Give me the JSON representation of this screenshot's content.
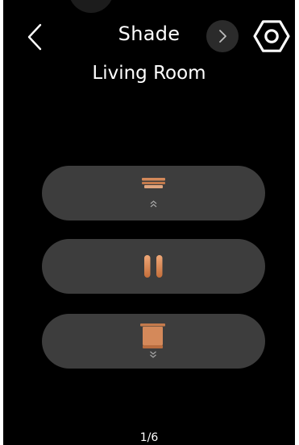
{
  "header": {
    "title": "Shade",
    "back_icon": "chevron-left-icon",
    "next_icon": "chevron-right-icon",
    "settings_icon": "hexagon-gear-icon"
  },
  "room": {
    "name": "Living Room"
  },
  "controls": [
    {
      "action": "open",
      "icon": "shade-open-icon"
    },
    {
      "action": "stop",
      "icon": "pause-icon"
    },
    {
      "action": "close",
      "icon": "shade-close-icon"
    }
  ],
  "pagination": {
    "text": "1/6"
  },
  "colors": {
    "background": "#000000",
    "button": "#3d3d3d",
    "accent": "#d4895a",
    "text": "#ffffff"
  }
}
